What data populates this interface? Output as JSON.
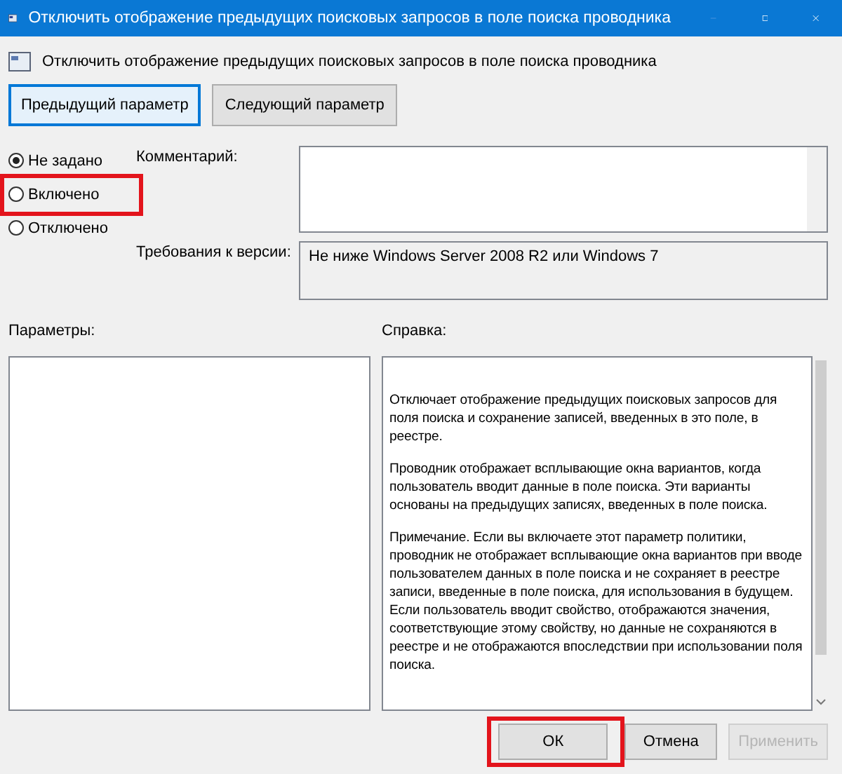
{
  "window": {
    "title": "Отключить отображение предыдущих поисковых запросов в поле поиска проводника"
  },
  "heading": "Отключить отображение предыдущих поисковых запросов в поле поиска проводника",
  "nav_buttons": [
    {
      "label": "Предыдущий параметр",
      "selected": true
    },
    {
      "label": "Следующий параметр",
      "selected": false
    }
  ],
  "options": [
    {
      "label": "Не задано",
      "selected": true,
      "highlighted": false
    },
    {
      "label": "Включено",
      "selected": false,
      "highlighted": true
    },
    {
      "label": "Отключено",
      "selected": false,
      "highlighted": false
    }
  ],
  "comment": {
    "label": "Комментарий:"
  },
  "version": {
    "label": "Требования к версии:",
    "value": "Не ниже Windows Server 2008 R2 или Windows 7"
  },
  "parameters": {
    "label": "Параметры:"
  },
  "help": {
    "label": "Справка:",
    "paragraphs": [
      "Отключает отображение предыдущих поисковых запросов для поля поиска и сохранение записей, введенных в это поле, в реестре.",
      "Проводник отображает всплывающие окна вариантов, когда пользователь вводит данные в поле поиска.  Эти варианты основаны на предыдущих записях, введенных в поле поиска.",
      "Примечание. Если вы включаете этот параметр политики, проводник не отображает всплывающие окна вариантов при вводе пользователем данных в поле поиска и не сохраняет в реестре записи, введенные в поле поиска, для использования в будущем.  Если пользователь вводит свойство, отображаются значения, соответствующие этому свойству, но данные не сохраняются в реестре и не отображаются впоследствии при использовании поля поиска."
    ]
  },
  "buttons": [
    {
      "label": "ОК",
      "disabled": false,
      "highlighted": true
    },
    {
      "label": "Отмена",
      "disabled": false,
      "highlighted": false
    },
    {
      "label": "Применить",
      "disabled": true,
      "highlighted": false
    }
  ]
}
